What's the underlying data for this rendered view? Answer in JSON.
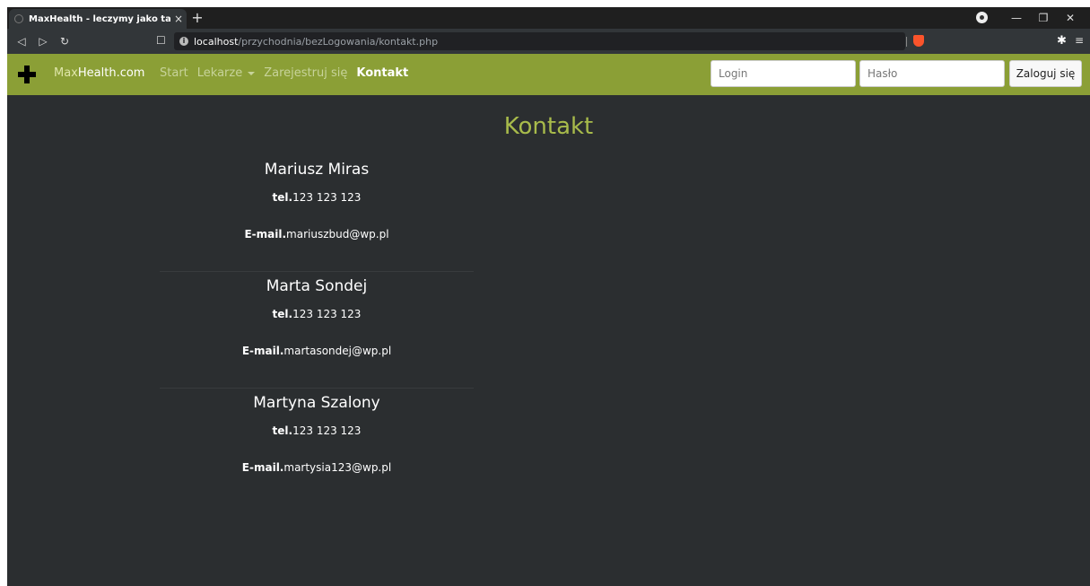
{
  "browser": {
    "tab_title": "MaxHealth - leczymy jako tako",
    "tab_close": "×",
    "new_tab": "+",
    "url_host": "localhost",
    "url_path": "/przychodnia/bezLogowania/kontakt.php",
    "controls": {
      "minimize": "—",
      "restore": "❐",
      "close": "✕"
    }
  },
  "navbar": {
    "brand_prefix": "Max",
    "brand_rest": "Health.com",
    "links": [
      {
        "label": "Start"
      },
      {
        "label": "Lekarze"
      },
      {
        "label": "Zarejestruj się"
      },
      {
        "label": "Kontakt"
      }
    ],
    "login_placeholder": "Login",
    "password_placeholder": "Hasło",
    "login_button": "Zaloguj się"
  },
  "page": {
    "title": "Kontakt",
    "tel_label": "tel.",
    "email_label": "E-mail.",
    "contacts": [
      {
        "name": "Mariusz Miras",
        "phone": "123 123 123",
        "email": "mariuszbud@wp.pl"
      },
      {
        "name": "Marta Sondej",
        "phone": "123 123 123",
        "email": "martasondej@wp.pl"
      },
      {
        "name": "Martyna Szalony",
        "phone": "123 123 123",
        "email": "martysia123@wp.pl"
      }
    ]
  }
}
